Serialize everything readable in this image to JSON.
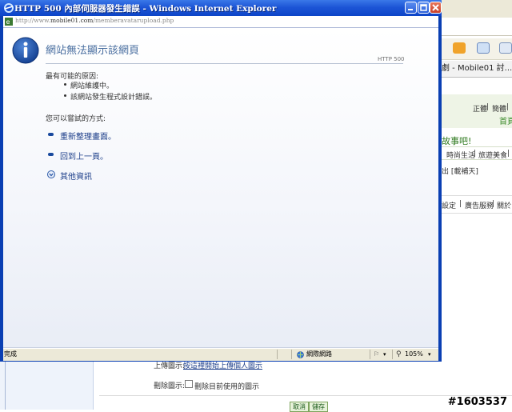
{
  "popup": {
    "title": "HTTP 500 內部伺服器發生錯誤 - Windows Internet Explorer",
    "address": {
      "prefix": "http://www.",
      "domain": "mobile01.com",
      "path": "/memberavatarupload.php"
    },
    "heading": "網站無法顯示該網頁",
    "http_code": "HTTP 500",
    "causes_title": "最有可能的原因:",
    "causes": [
      "網站維護中。",
      "該網站發生程式設計錯誤。"
    ],
    "actions_title": "您可以嘗試的方式:",
    "actions": [
      "重新整理畫面。",
      "回到上一頁。"
    ],
    "more_info": "其他資訊",
    "status": {
      "done": "完成",
      "zone": "網際網路",
      "zoom": "105%"
    }
  },
  "background": {
    "tab_title": "劇 - Mobile01 討...",
    "top_links": [
      "正體",
      "簡體"
    ],
    "home_link": "首頁",
    "story_text": "故事吧!",
    "nav_items": [
      "時尚生活",
      "旅遊美食"
    ],
    "user_text": "出 [載補天]",
    "settings_links": [
      "設定",
      "廣告服務",
      "關於"
    ],
    "upload_label": "上傳圖示:",
    "upload_link": "按這裡開始上傳個人圖示",
    "delete_label": "刪除圖示:",
    "delete_checkbox_label": "刪除目前使用的圖示",
    "cancel_button": "取消",
    "save_button": "儲存",
    "watermark": "#1603537"
  },
  "colors": {
    "titlebar": "#1d55d6",
    "heading": "#4a6fa0",
    "link": "#1d3f8a",
    "green": "#2f7a1f"
  },
  "icons": [
    "ie-icon",
    "minimize-icon",
    "maximize-icon",
    "close-icon",
    "page-icon",
    "info-icon",
    "action-bullet-icon",
    "expand-icon",
    "globe-icon",
    "zoom-icon"
  ]
}
